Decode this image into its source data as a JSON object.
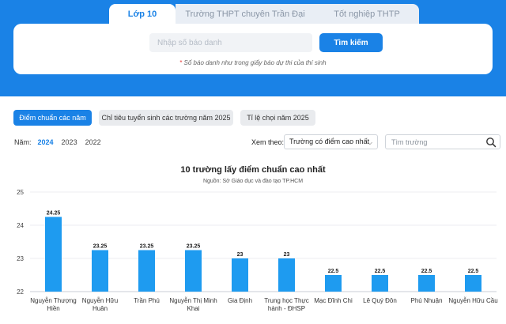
{
  "tabs": [
    {
      "label": "Lớp 10",
      "active": true
    },
    {
      "label": "Trường THPT chuyên Trần Đại Nghĩa",
      "active": false
    },
    {
      "label": "Tốt nghiệp THTP",
      "active": false
    }
  ],
  "search": {
    "placeholder": "Nhập số báo danh",
    "value": "",
    "button_label": "Tìm kiếm",
    "hint_star": "*",
    "hint": "Số báo danh như trong giấy báo dự thi của thí sinh"
  },
  "filters": {
    "pills": [
      "Điểm chuẩn các năm",
      "Chỉ tiêu tuyển sinh các trường năm 2025",
      "Tỉ lệ chọi năm 2025"
    ],
    "year_label": "Năm:",
    "years": [
      "2024",
      "2023",
      "2022"
    ],
    "active_year": "2024",
    "view_label": "Xem theo:",
    "view_selected": "Trường có điểm cao nhất",
    "school_search_placeholder": "Tìm trường"
  },
  "colors": {
    "accent": "#1a82e6",
    "bar": "#1e9bf0"
  },
  "icons": {
    "search": "search-icon",
    "caret": "chevron-down-icon"
  },
  "chart_data": {
    "type": "bar",
    "title": "10 trường lấy điểm chuẩn cao nhất",
    "subtitle": "Nguồn: Sở Giáo dục và đào tạo TP.HCM",
    "categories": [
      [
        "Nguyễn Thượng",
        "Hiền"
      ],
      [
        "Nguyễn Hữu",
        "Huân"
      ],
      [
        "Trần Phú"
      ],
      [
        "Nguyễn Thị Minh",
        "Khai"
      ],
      [
        "Gia Định"
      ],
      [
        "Trung học Thực",
        "hành - ĐHSP"
      ],
      [
        "Mạc Đĩnh Chi"
      ],
      [
        "Lê Quý Đôn"
      ],
      [
        "Phú Nhuận"
      ],
      [
        "Nguyễn Hữu Cầu"
      ]
    ],
    "values": [
      24.25,
      23.25,
      23.25,
      23.25,
      23,
      23,
      22.5,
      22.5,
      22.5,
      22.5
    ],
    "data_labels": [
      "24.25",
      "23.25",
      "23.25",
      "23.25",
      "23",
      "23",
      "22.5",
      "22.5",
      "22.5",
      "22.5"
    ],
    "y_ticks": [
      "22",
      "23",
      "24",
      "25"
    ],
    "ylim": [
      22,
      25
    ],
    "grid": true,
    "legend": "bottom"
  }
}
